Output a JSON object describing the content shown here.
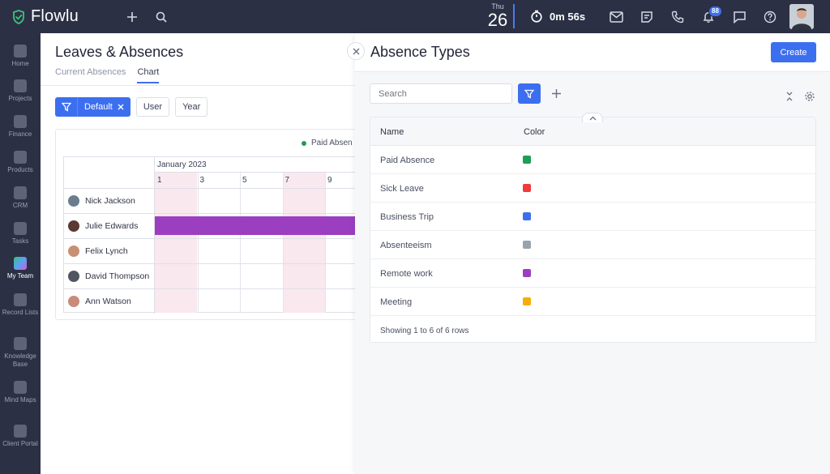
{
  "app": {
    "name": "Flowlu"
  },
  "topbar": {
    "date_dow": "Thu",
    "date_day": "26",
    "timer": "0m 56s",
    "notifications_count": "88"
  },
  "sidebar": {
    "items": [
      {
        "label": "Home",
        "icon": "home-icon"
      },
      {
        "label": "Projects",
        "icon": "projects-icon"
      },
      {
        "label": "Finance",
        "icon": "finance-icon"
      },
      {
        "label": "Products",
        "icon": "products-icon"
      },
      {
        "label": "CRM",
        "icon": "crm-icon"
      },
      {
        "label": "Tasks",
        "icon": "tasks-icon"
      },
      {
        "label": "My Team",
        "icon": "team-icon",
        "active": true
      },
      {
        "label": "Record Lists",
        "icon": "record-lists-icon"
      },
      {
        "label": "Knowledge Base",
        "icon": "knowledge-base-icon"
      },
      {
        "label": "Mind Maps",
        "icon": "mind-maps-icon"
      },
      {
        "label": "Client Portal",
        "icon": "client-portal-icon"
      }
    ]
  },
  "main": {
    "title": "Leaves & Absences",
    "tabs": [
      {
        "label": "Current Absences",
        "active": false
      },
      {
        "label": "Chart",
        "active": true
      }
    ],
    "filter_label": "Default",
    "period_buttons": [
      "User",
      "Year"
    ],
    "chart": {
      "legend": "Paid Absen",
      "month": "January 2023",
      "days": [
        "1",
        "3",
        "5",
        "7",
        "9"
      ],
      "people": [
        {
          "name": "Nick Jackson",
          "bar": false
        },
        {
          "name": "Julie Edwards",
          "bar": true
        },
        {
          "name": "Felix Lynch",
          "bar": false
        },
        {
          "name": "David Thompson",
          "bar": false
        },
        {
          "name": "Ann Watson",
          "bar": false
        }
      ]
    }
  },
  "panel": {
    "title": "Absence Types",
    "create_label": "Create",
    "search_placeholder": "Search",
    "columns": {
      "name": "Name",
      "color": "Color"
    },
    "rows": [
      {
        "name": "Paid Absence",
        "color": "#1f9d55"
      },
      {
        "name": "Sick Leave",
        "color": "#ef3b3b"
      },
      {
        "name": "Business Trip",
        "color": "#3c6ff0"
      },
      {
        "name": "Absenteeism",
        "color": "#9aa3ad"
      },
      {
        "name": "Remote work",
        "color": "#9b3fc0"
      },
      {
        "name": "Meeting",
        "color": "#f5ae0b"
      }
    ],
    "footer": "Showing 1 to 6 of 6 rows"
  },
  "colors": {
    "accent": "#3c6ff0",
    "topbar_bg": "#2c3045",
    "bar": "#9b3fc0",
    "weekend": "#fae8ef"
  }
}
